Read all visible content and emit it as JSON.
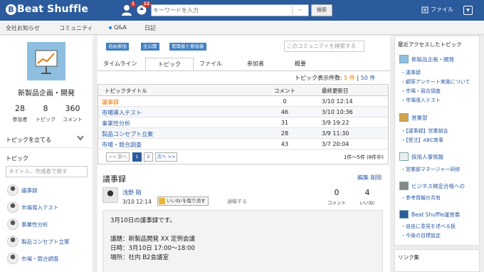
{
  "header": {
    "logo_text": "Beat Shuffle",
    "user_badge": "1",
    "notify_badge": "12",
    "search_placeholder": "キーワードを入力",
    "search_dropdown": "--",
    "search_button": "検索",
    "file_label": "ファイル",
    "dropdown_glyph": "▼"
  },
  "nav": [
    "全社お知らせ",
    "コミュニティ",
    "Q&A",
    "日記"
  ],
  "left": {
    "community_name": "新製品企画・開発",
    "stats": [
      {
        "num": "28",
        "label": "参加者"
      },
      {
        "num": "8",
        "label": "トピック"
      },
      {
        "num": "360",
        "label": "コメント"
      }
    ],
    "start_topic": "トピックを立てる",
    "topic_header": "トピック",
    "topic_search_placeholder": "タイトル、作成者で探す",
    "topics": [
      "議事録",
      "市場導入テスト",
      "事業性分析",
      "製品コンセプト立案",
      "市場・競合調査"
    ]
  },
  "center": {
    "tags": [
      "自由参加",
      "全公開",
      "管理者と参加者"
    ],
    "community_search_placeholder": "このコミュニティを検索する",
    "tabs": [
      "タイムライン",
      "トピック",
      "ファイル",
      "参加者",
      "概要"
    ],
    "count_label": "トピック表示件数:",
    "count_opt1": "5 件",
    "count_sep": "|",
    "count_opt2": "50 件",
    "table": {
      "headers": {
        "title": "トピックタイトル",
        "comments": "コメント",
        "updated": "最終更新日"
      },
      "rows": [
        {
          "title": "議事録",
          "comments": "0",
          "updated": "3/10 12:14"
        },
        {
          "title": "市場導入テスト",
          "comments": "46",
          "updated": "3/10 10:36"
        },
        {
          "title": "事業性分析",
          "comments": "31",
          "updated": "3/9 19:22"
        },
        {
          "title": "製品コンセプト立案",
          "comments": "28",
          "updated": "3/9 11:30"
        },
        {
          "title": "市場・競合調査",
          "comments": "43",
          "updated": "3/7 20:04"
        }
      ]
    },
    "pager": {
      "prev": "<< 前へ",
      "page1": "1",
      "page2": "2",
      "next": "次へ >>",
      "range": "1件〜5件 (8件中)"
    },
    "post": {
      "title": "議事録",
      "edit": "編集",
      "delete": "削除",
      "author": "浅野 剛",
      "datetime": "3/10 12:14",
      "like_button": "いいね!を取り消す",
      "report": "通報する",
      "comment_count": "0",
      "comment_label": "コメント",
      "like_count": "4",
      "like_label": "いいね!",
      "body_lines": [
        "3月10日の議事録です。",
        "",
        "議題：新製品開発 XX 定例会議",
        "日時：3月10日 17:00～18:00",
        "場所：社内 B2会議室"
      ]
    }
  },
  "right": {
    "recent_header": "最近アクセスしたトピック",
    "groups": [
      {
        "title": "新製品企画・開発",
        "items": [
          "議事録",
          "顧客アンケート実施について",
          "市場・競合調査",
          "市場導入テスト"
        ]
      },
      {
        "title": "営業部",
        "items": [
          "【議事録】営業部会",
          "【受注】ABC商事"
        ]
      },
      {
        "title": "採用人事情報",
        "items": [
          "営業部マネージャー研修"
        ]
      },
      {
        "title": "ビジネス検定合格への",
        "items": [
          "参考情報の共有"
        ]
      },
      {
        "title": "Beat Shuffle運営委",
        "items": [
          "自由に意見を述べる板",
          "今後の目標設定"
        ]
      }
    ],
    "links_header": "リンク集"
  }
}
